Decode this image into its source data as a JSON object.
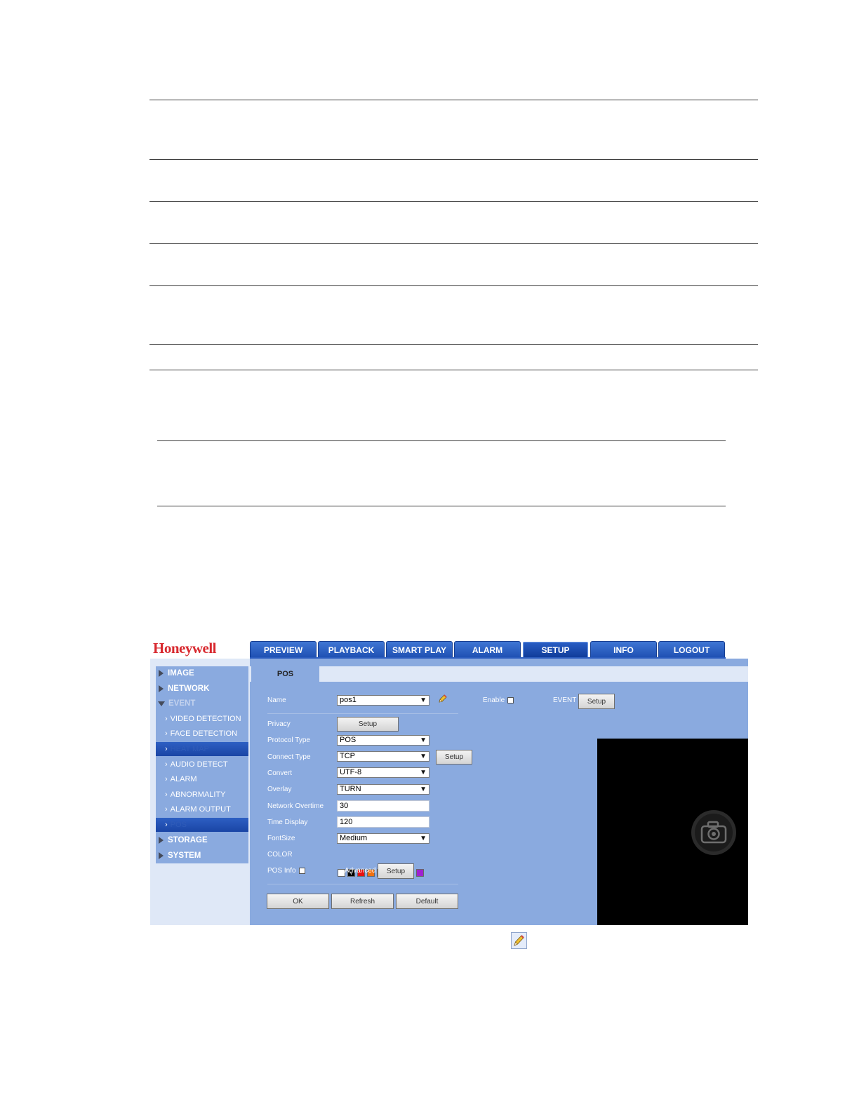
{
  "nav": {
    "logo": "Honeywell",
    "tabs": [
      "PREVIEW",
      "PLAYBACK",
      "SMART PLAY",
      "ALARM",
      "SETUP",
      "INFO",
      "LOGOUT"
    ],
    "active_tab": "SETUP"
  },
  "sidebar": {
    "items": [
      {
        "label": "IMAGE"
      },
      {
        "label": "NETWORK"
      },
      {
        "label": "EVENT"
      },
      {
        "label": "VIDEO DETECTION"
      },
      {
        "label": "FACE DETECTION"
      },
      {
        "label": "HEAT MAP"
      },
      {
        "label": "AUDIO DETECT"
      },
      {
        "label": "ALARM"
      },
      {
        "label": "ABNORMALITY"
      },
      {
        "label": "ALARM OUTPUT"
      },
      {
        "label": "POS"
      },
      {
        "label": "STORAGE"
      },
      {
        "label": "SYSTEM"
      }
    ]
  },
  "page": {
    "tab": "POS",
    "name_label": "Name",
    "name_value": "pos1",
    "enable_label": "Enable",
    "event_label": "EVENT",
    "setup_label": "Setup",
    "privacy_label": "Privacy",
    "protocol_label": "Protocol Type",
    "protocol_value": "POS",
    "connect_label": "Connect Type",
    "connect_value": "TCP",
    "convert_label": "Convert",
    "convert_value": "UTF-8",
    "overlay_label": "Overlay",
    "overlay_value": "TURN",
    "network_overtime_label": "Network Overtime",
    "network_overtime_value": "30",
    "time_display_label": "Time Display",
    "time_display_value": "120",
    "fontsize_label": "FontSize",
    "fontsize_value": "Medium",
    "color_label": "COLOR",
    "colors": [
      "#ffffff",
      "#000000",
      "#e81010",
      "#f07010",
      "#f0e010",
      "#30d020",
      "#1030e0",
      "#3020c0",
      "#a020d0"
    ],
    "selected_color_mark": "√",
    "pos_info_label": "POS Info",
    "advanced_label": "Advanced",
    "ok_label": "OK",
    "refresh_label": "Refresh",
    "default_label": "Default"
  }
}
